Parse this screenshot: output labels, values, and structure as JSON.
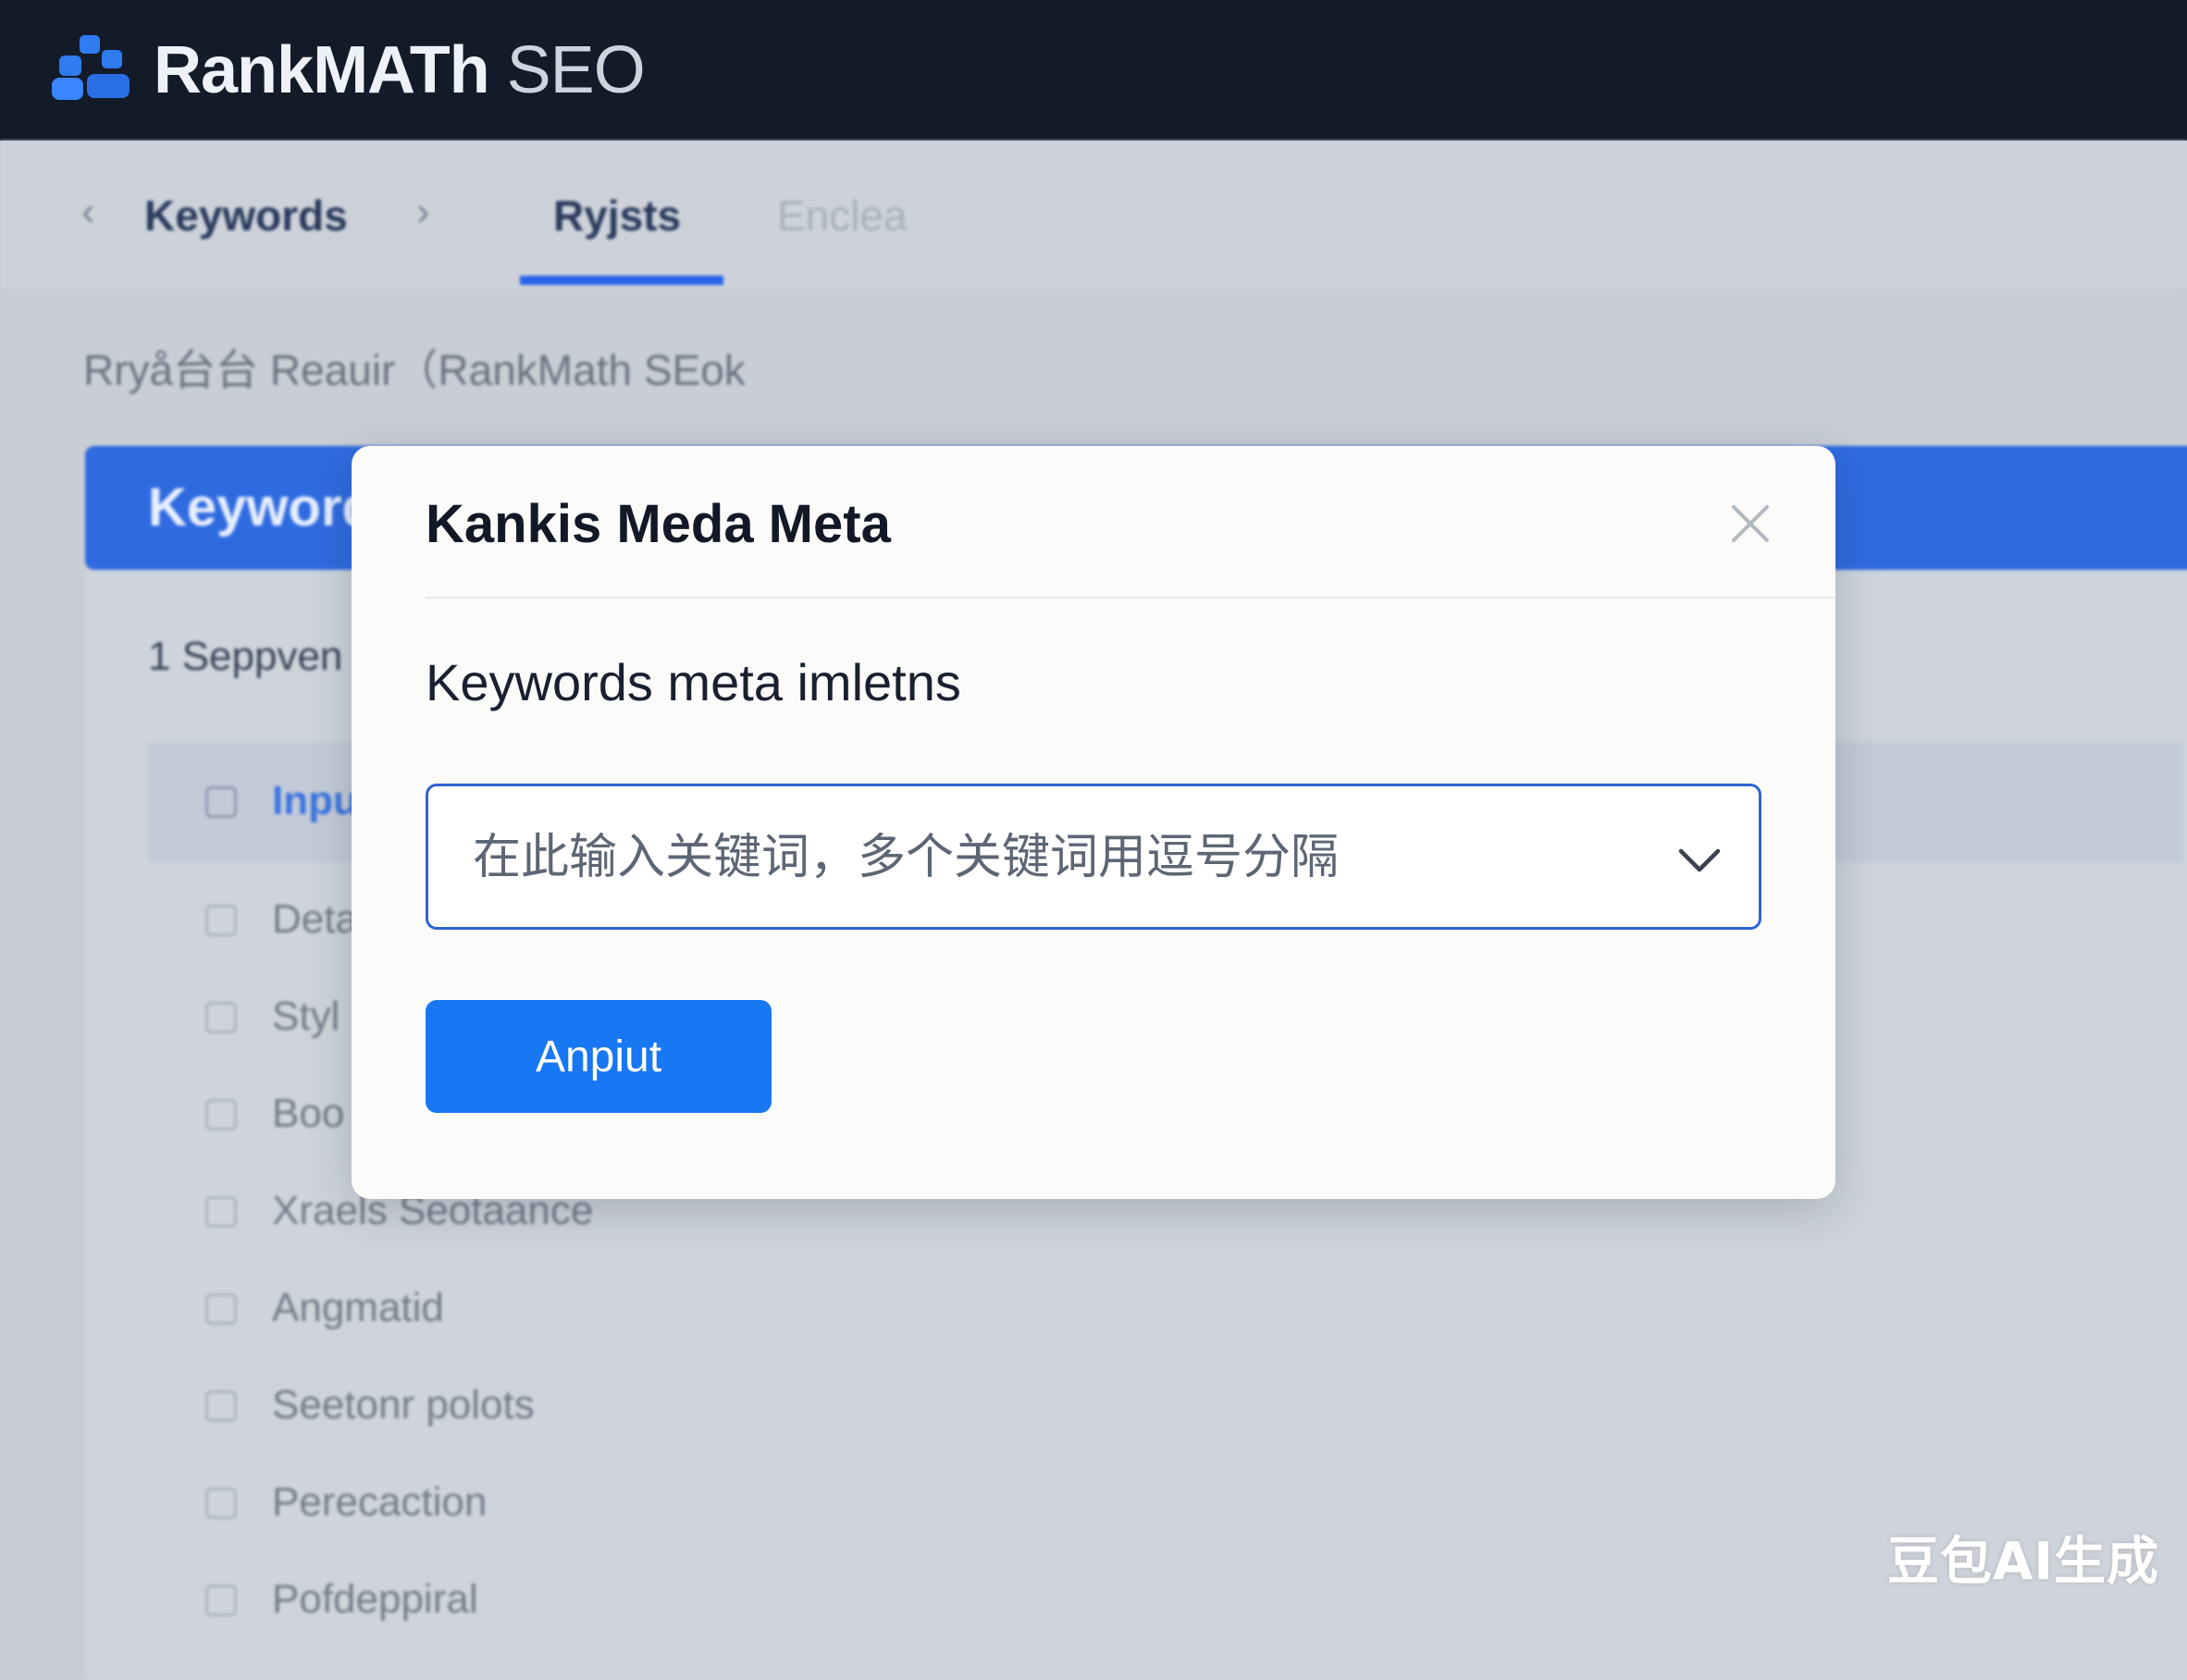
{
  "app": {
    "brand_bold": "RankMATh",
    "brand_light": " SEO",
    "logo_icon": "rankmath-logo-icon"
  },
  "tabs": {
    "back_icon": "chevron-left-icon",
    "forward_icon": "chevron-right-icon",
    "items": [
      {
        "label": "Keywords",
        "state": "normal"
      },
      {
        "label": "Ryjsts",
        "state": "selected"
      },
      {
        "label": "Enclea",
        "state": "faded"
      }
    ]
  },
  "page": {
    "heading": "Rryå台台 Reauir（RankMath SEok"
  },
  "background_panel": {
    "header_label": "Keyword",
    "step_label": "1  Seppven",
    "items": [
      {
        "label": "Inpu",
        "active": true
      },
      {
        "label": "Deta",
        "active": false
      },
      {
        "label": "Styl",
        "active": false
      },
      {
        "label": "Boo",
        "active": false
      },
      {
        "label": "Xraels Seotaance",
        "active": false
      },
      {
        "label": "Angmatid",
        "active": false
      },
      {
        "label": "Seetonr polots",
        "active": false
      },
      {
        "label": "Perecaction",
        "active": false
      },
      {
        "label": "Pofdeppiral",
        "active": false
      }
    ]
  },
  "modal": {
    "title": "Kankis Meda Meta",
    "close_icon": "close-icon",
    "field_label": "Keywords meta imletns",
    "select_placeholder": "在此输入关键词，多个关键词用逗号分隔",
    "select_icon": "chevron-down-icon",
    "primary_button": "Anpiut"
  },
  "watermark": "豆包AI生成",
  "colors": {
    "topbar": "#131b29",
    "accent": "#1877f2",
    "tab_underline": "#2563eb",
    "blue_header": "#2f6be0"
  }
}
